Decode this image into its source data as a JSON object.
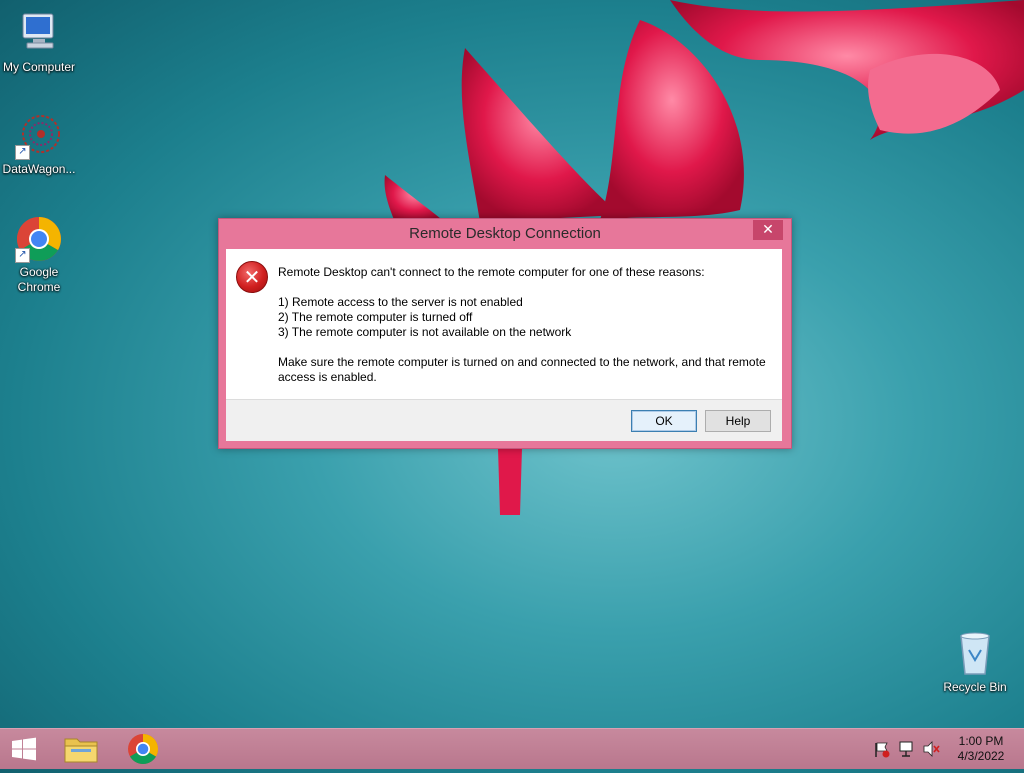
{
  "desktop": {
    "icons": [
      {
        "label": "My Computer"
      },
      {
        "label": "DataWagon..."
      },
      {
        "label": "Google\nChrome"
      },
      {
        "label": "Recycle Bin"
      }
    ]
  },
  "dialog": {
    "title": "Remote Desktop Connection",
    "close_glyph": "✕",
    "message": {
      "intro": "Remote Desktop can't connect to the remote computer for one of these reasons:",
      "reasons": [
        "1) Remote access to the server is not enabled",
        "2) The remote computer is turned off",
        "3) The remote computer is not available on the network"
      ],
      "advice": "Make sure the remote computer is turned on and connected to the network, and that remote access is enabled."
    },
    "buttons": {
      "ok": "OK",
      "help": "Help"
    }
  },
  "taskbar": {
    "clock": {
      "time": "1:00 PM",
      "date": "4/3/2022"
    }
  },
  "colors": {
    "dialog_frame": "#e7779a",
    "taskbar": "#c7899d",
    "error": "#d01f1f"
  }
}
